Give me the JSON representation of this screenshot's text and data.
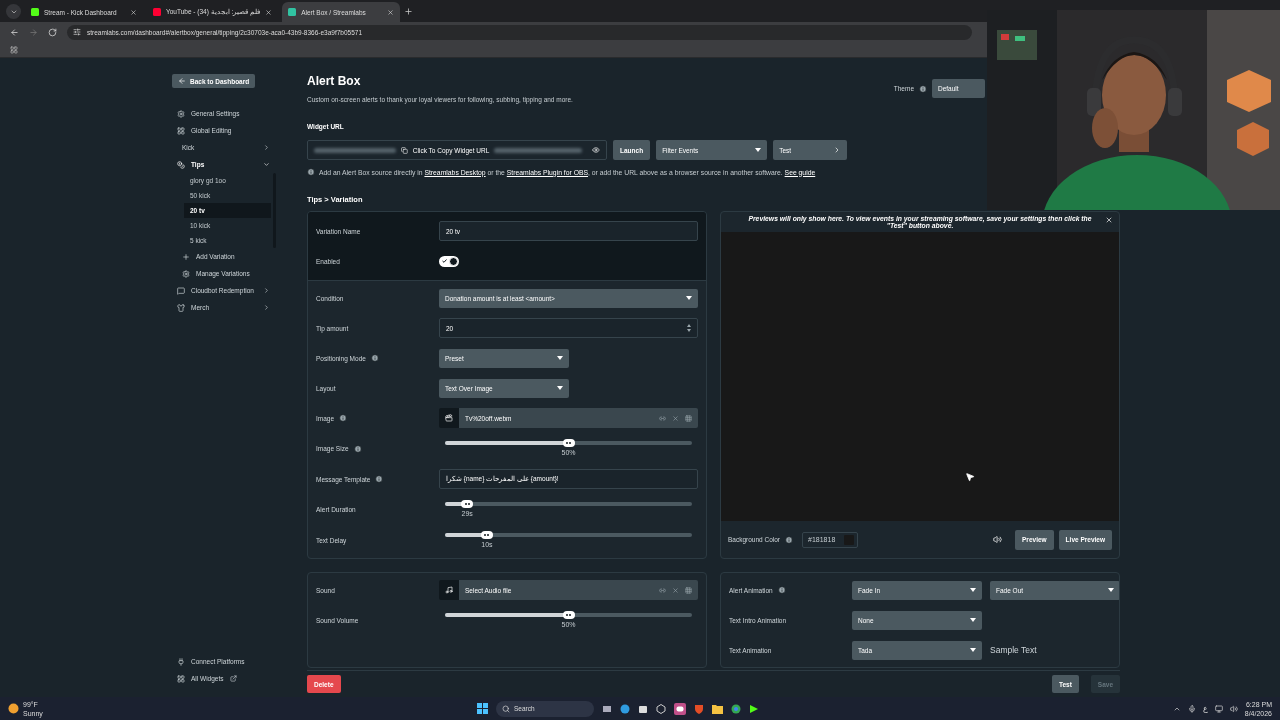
{
  "browser": {
    "tabs": [
      {
        "title": "Stream - Kick Dashboard",
        "selected": false
      },
      {
        "title": "YouTube - فلم قصير: ابجدية (34)",
        "selected": false
      },
      {
        "title": "Alert Box / Streamlabs",
        "selected": true
      }
    ],
    "url": "streamlabs.com/dashboard#/alertbox/general/tipping/2c30703e-aca0-43b9-8366-e3a9f7b05571"
  },
  "sidebar": {
    "back_button": "Back to Dashboard",
    "items": [
      {
        "label": "General Settings",
        "kind": "link"
      },
      {
        "label": "Global Editing",
        "kind": "link"
      },
      {
        "label": "Kick",
        "kind": "group",
        "expanded": false
      },
      {
        "label": "Tips",
        "kind": "group",
        "expanded": true,
        "children": [
          {
            "label": "glory gd 1oo",
            "selected": false
          },
          {
            "label": "50 kick",
            "selected": false
          },
          {
            "label": "20 tv",
            "selected": true
          },
          {
            "label": "10 kick",
            "selected": false
          },
          {
            "label": "5 kick",
            "selected": false
          }
        ],
        "actions": [
          "Add Variation",
          "Manage Variations"
        ]
      },
      {
        "label": "Cloudbot Redemption",
        "kind": "group",
        "expanded": false
      },
      {
        "label": "Merch",
        "kind": "group",
        "expanded": false
      }
    ],
    "footer": [
      "Connect Platforms",
      "All Widgets"
    ]
  },
  "header": {
    "title": "Alert Box",
    "description": "Custom on-screen alerts to thank your loyal viewers for following, subbing, tipping and more.",
    "theme_label": "Theme",
    "theme_value": "Default"
  },
  "widget_url": {
    "label": "Widget URL",
    "copy_label": "Click To Copy Widget URL",
    "launch": "Launch",
    "filter": "Filter Events",
    "test": "Test",
    "help": [
      {
        "text": "Add an Alert Box source directly in ",
        "link": false
      },
      {
        "text": "Streamlabs Desktop",
        "link": true
      },
      {
        "text": " or the ",
        "link": false
      },
      {
        "text": "Streamlabs Plugin for OBS",
        "link": true
      },
      {
        "text": ", or add the URL above as a browser source in another software. ",
        "link": false
      },
      {
        "text": "See guide",
        "link": true
      }
    ]
  },
  "breadcrumb": "Tips > Variation",
  "basic": [
    {
      "label": "Variation Name",
      "kind": "text",
      "value": "20 tv",
      "info": false
    },
    {
      "label": "Enabled",
      "kind": "toggle",
      "on": true,
      "info": false
    }
  ],
  "settings": [
    {
      "label": "Condition",
      "kind": "condition",
      "value": "Donation amount is at least <amount>",
      "info": false
    },
    {
      "label": "Tip amount",
      "kind": "number",
      "value": "20",
      "info": false
    },
    {
      "label": "Positioning Mode",
      "kind": "select",
      "value": "Preset",
      "info": true
    },
    {
      "label": "Layout",
      "kind": "select",
      "value": "Text Over Image",
      "info": false
    },
    {
      "label": "Image",
      "kind": "file",
      "value": "Tv%20off.webm",
      "info": true
    },
    {
      "label": "Image Size",
      "kind": "slider",
      "level": 0.5,
      "reading": "50%",
      "info": true
    },
    {
      "label": "Message Template",
      "kind": "text",
      "value": "شكرا {name} على المفرحات {amount}!",
      "info": true
    },
    {
      "label": "Alert Duration",
      "kind": "slider",
      "level": 0.09,
      "reading": "29s",
      "info": false
    },
    {
      "label": "Text Delay",
      "kind": "slider",
      "level": 0.17,
      "reading": "10s",
      "info": false
    }
  ],
  "preview": {
    "notice": "Previews will only show here. To view events in your streaming software, save your settings then click the \"Test\" button above.",
    "background_label": "Background Color",
    "background_value": "#181818",
    "buttons": [
      "Preview",
      "Live Preview"
    ]
  },
  "sound": [
    {
      "label": "Sound",
      "kind": "file",
      "value": "Select Audio file",
      "info": false
    },
    {
      "label": "Sound Volume",
      "kind": "slider",
      "level": 0.5,
      "reading": "50%",
      "info": false
    }
  ],
  "animation": [
    {
      "label": "Alert Animation",
      "info": true,
      "selects": [
        "Fade In",
        "Fade Out"
      ]
    },
    {
      "label": "Text Intro Animation",
      "info": false,
      "selects": [
        "None"
      ]
    },
    {
      "label": "Text Animation",
      "info": false,
      "selects": [
        "Tada"
      ],
      "sample": "Sample Text"
    }
  ],
  "footer": {
    "delete": "Delete",
    "test": "Test",
    "save": {
      "label": "Save",
      "disabled": true
    }
  },
  "taskbar": {
    "temp": "99°F",
    "condition": "Sunny",
    "search": "Search",
    "language": "ع",
    "time": "6:28 PM",
    "date": "8/4/2026"
  }
}
